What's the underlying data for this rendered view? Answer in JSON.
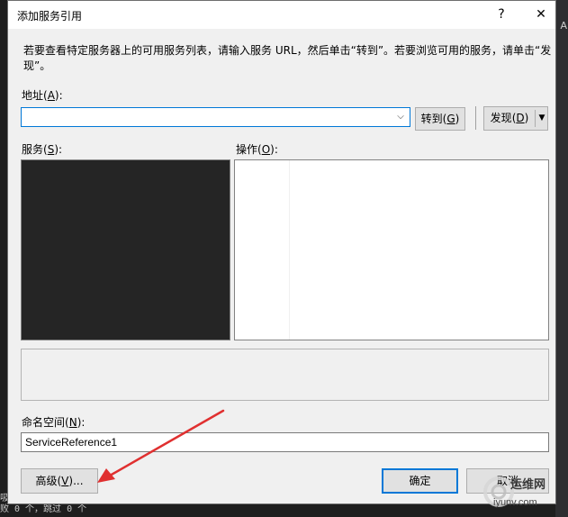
{
  "dialog": {
    "title": "添加服务引用",
    "help_label": "?",
    "close_label": "✕",
    "description": "若要查看特定服务器上的可用服务列表，请输入服务 URL，然后单击“转到”。若要浏览可用的服务，请单击“发现”。"
  },
  "address": {
    "label": "地址",
    "access_key": "A",
    "value": "",
    "dropdown_glyph": "⌵"
  },
  "buttons": {
    "go": {
      "label": "转到",
      "access_key": "G"
    },
    "discover": {
      "label": "发现",
      "access_key": "D"
    },
    "advanced": {
      "label": "高级",
      "access_key": "V",
      "suffix": "..."
    },
    "ok": {
      "label": "确定"
    },
    "cancel": {
      "label": "取消"
    }
  },
  "services": {
    "label": "服务",
    "access_key": "S"
  },
  "operations": {
    "label": "操作",
    "access_key": "O"
  },
  "namespace": {
    "label": "命名空间",
    "access_key": "N",
    "value": "ServiceReference1"
  },
  "background": {
    "right_text": "A",
    "bottom_lines": [
      "吸",
      "败 0 个，跳过 0 个"
    ]
  },
  "watermark": {
    "brand": "运维网",
    "domain": "iyunv.com"
  },
  "colors": {
    "accent": "#0078d7",
    "annotation_arrow": "#e03030",
    "dark_panel": "#252525"
  }
}
